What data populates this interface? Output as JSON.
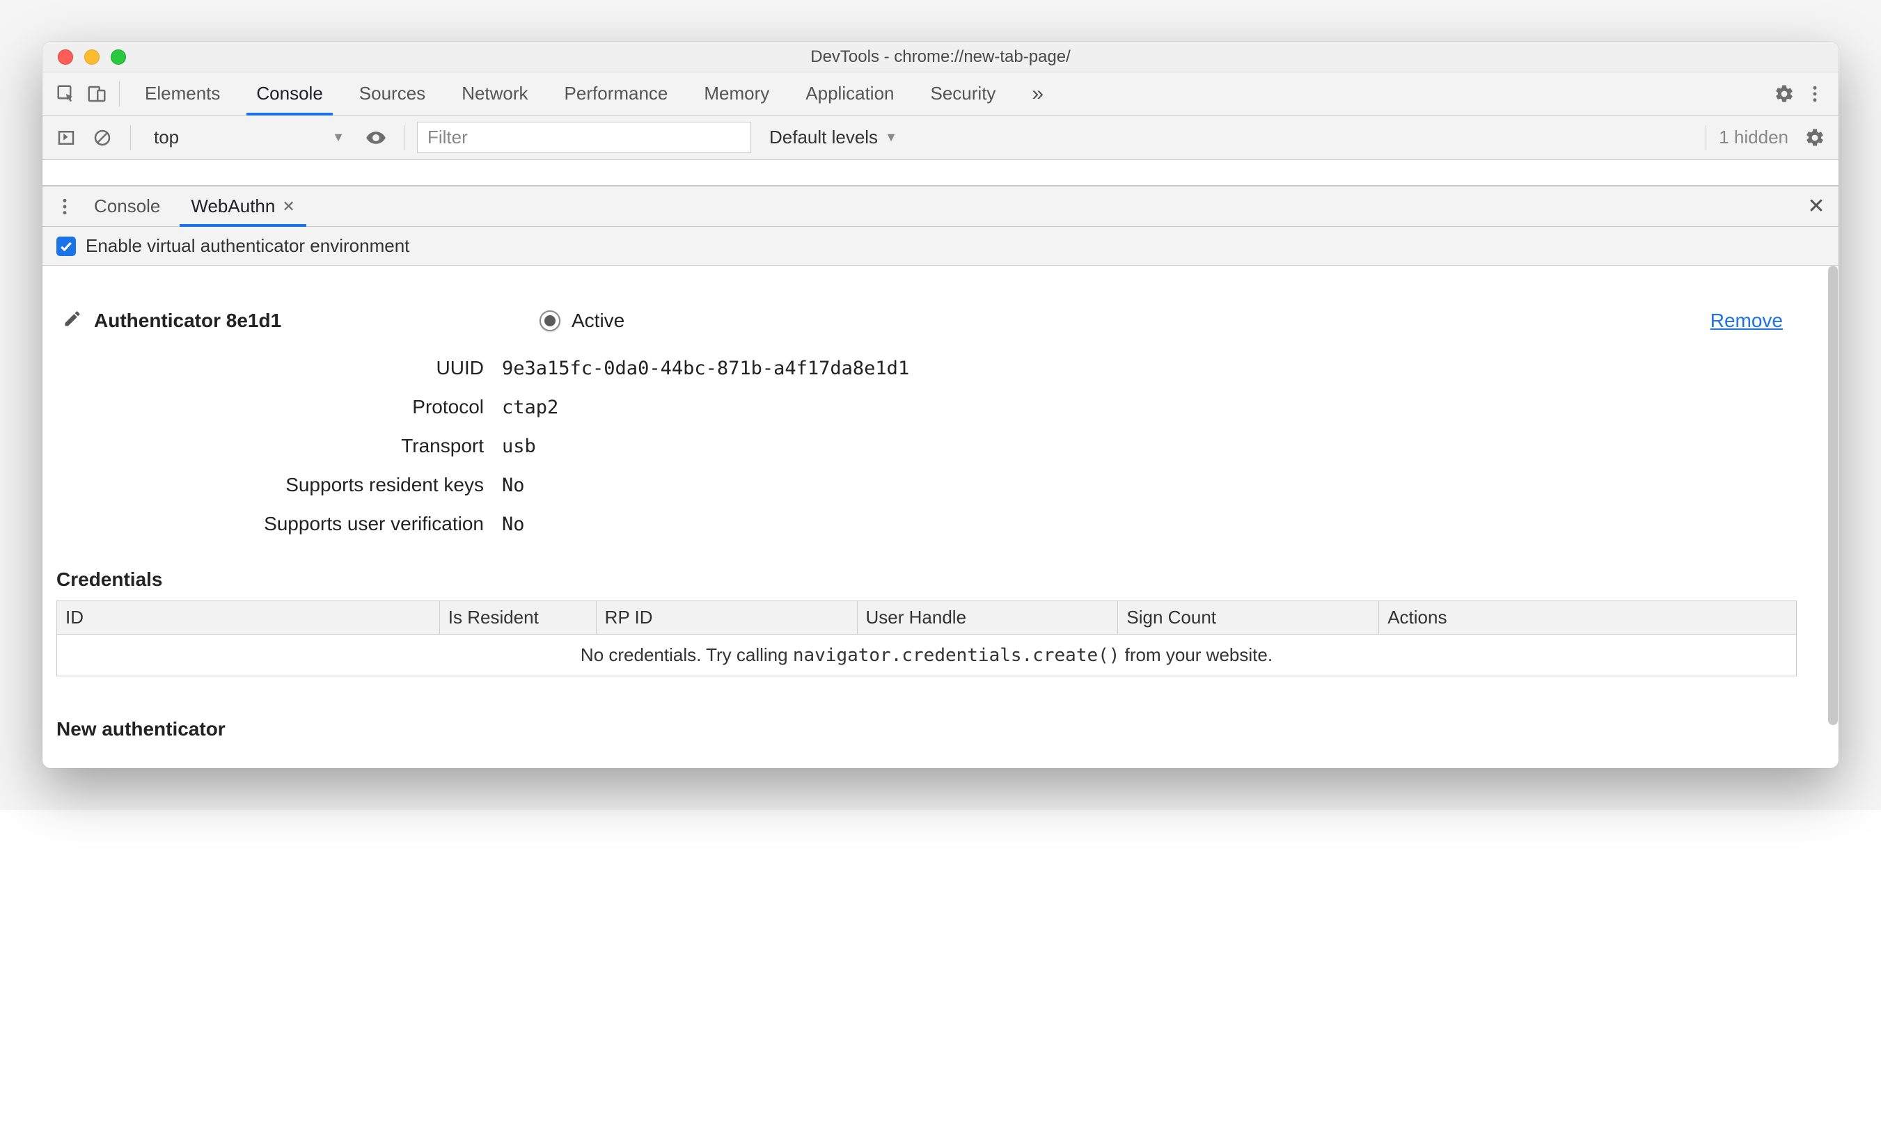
{
  "window": {
    "title": "DevTools - chrome://new-tab-page/"
  },
  "main_tabs": {
    "items": [
      "Elements",
      "Console",
      "Sources",
      "Network",
      "Performance",
      "Memory",
      "Application",
      "Security"
    ],
    "active_index": 1
  },
  "console_bar": {
    "context": "top",
    "filter_placeholder": "Filter",
    "levels_label": "Default levels",
    "hidden_text": "1 hidden"
  },
  "drawer": {
    "tabs": [
      "Console",
      "WebAuthn"
    ],
    "active_index": 1
  },
  "webauthn": {
    "enable_label": "Enable virtual authenticator environment",
    "enable_checked": true,
    "authenticator": {
      "name": "Authenticator 8e1d1",
      "active_label": "Active",
      "remove_label": "Remove",
      "props": {
        "uuid_label": "UUID",
        "uuid_value": "9e3a15fc-0da0-44bc-871b-a4f17da8e1d1",
        "protocol_label": "Protocol",
        "protocol_value": "ctap2",
        "transport_label": "Transport",
        "transport_value": "usb",
        "resident_label": "Supports resident keys",
        "resident_value": "No",
        "userverify_label": "Supports user verification",
        "userverify_value": "No"
      }
    },
    "credentials": {
      "heading": "Credentials",
      "columns": [
        "ID",
        "Is Resident",
        "RP ID",
        "User Handle",
        "Sign Count",
        "Actions"
      ],
      "empty_prefix": "No credentials. Try calling ",
      "empty_code": "navigator.credentials.create()",
      "empty_suffix": " from your website."
    },
    "new_auth_heading": "New authenticator"
  }
}
